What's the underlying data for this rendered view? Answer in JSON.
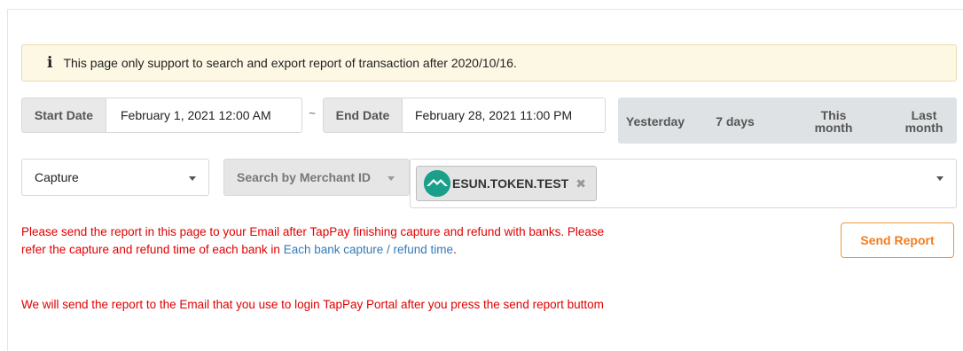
{
  "notice": {
    "text": "This page only support to search and export report of transaction after 2020/10/16."
  },
  "date_range": {
    "start_label": "Start Date",
    "start_value": "February 1, 2021 12:00 AM",
    "separator": "~",
    "end_label": "End Date",
    "end_value": "February 28, 2021 11:00 PM"
  },
  "quick_range": {
    "yesterday": "Yesterday",
    "seven_days": "7 days",
    "this_month_line1": "This",
    "this_month_line2": "month",
    "last_month_line1": "Last",
    "last_month_line2": "month"
  },
  "filters": {
    "type_selected": "Capture",
    "search_by_label": "Search by Merchant ID",
    "merchant_tag": "ESUN.TOKEN.TEST",
    "tag_remove": "✖"
  },
  "messages": {
    "report_info_before_link": "Please send the report in this page to your Email after TapPay finishing capture and refund with banks. Please refer the capture and refund time of each bank in ",
    "report_info_link": "Each bank capture / refund time",
    "report_info_after_link": ".",
    "email_info": "We will send the report to the Email that you use to login TapPay Portal after you press the send report buttom"
  },
  "actions": {
    "send_report": "Send Report"
  },
  "colors": {
    "notice_bg": "#fcf8e3",
    "error_red": "#e00000",
    "link_blue": "#337ab7",
    "send_orange": "#f07d1f",
    "logo_teal": "#1aa08a"
  }
}
